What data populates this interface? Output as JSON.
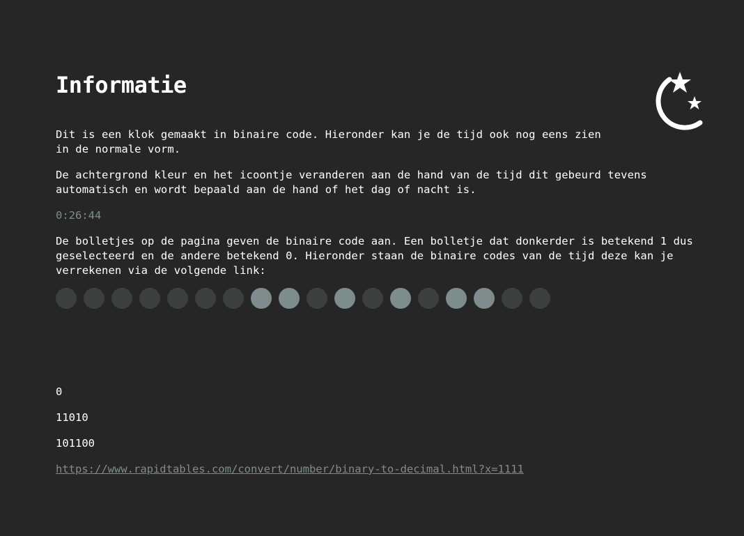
{
  "page": {
    "title": "Informatie",
    "paragraph1": "Dit is een klok gemaakt in binaire code. Hieronder kan je de tijd ook nog eens zien\nin de normale vorm.",
    "paragraph2": "De achtergrond kleur en het icoontje veranderen aan de hand van de tijd dit gebeurd tevens\nautomatisch en wordt bepaald aan de hand of het dag of nacht is.",
    "time": "0:26:44",
    "paragraph3": "De bolletjes op de pagina geven de binaire code aan. Een bolletje dat donkerder is betekend 1 dus\ngeselecteerd en de andere betekend 0. Hieronder staan de binaire codes van de tijd deze kan je\nverrekenen via de volgende link:",
    "binary_hours": "0",
    "binary_minutes": "11010",
    "binary_seconds": "101100",
    "link_text": "https://www.rapidtables.com/convert/number/binary-to-decimal.html?x=1111"
  },
  "dots": [
    0,
    0,
    0,
    0,
    0,
    0,
    0,
    1,
    1,
    0,
    1,
    0,
    1,
    0,
    1,
    1,
    0,
    0
  ],
  "icon": "moon-stars-icon",
  "colors": {
    "background": "#262626",
    "dot_off": "#3b3f40",
    "dot_on": "#7f8c8d",
    "muted_text": "#7f8c8d",
    "text": "#ffffff"
  }
}
